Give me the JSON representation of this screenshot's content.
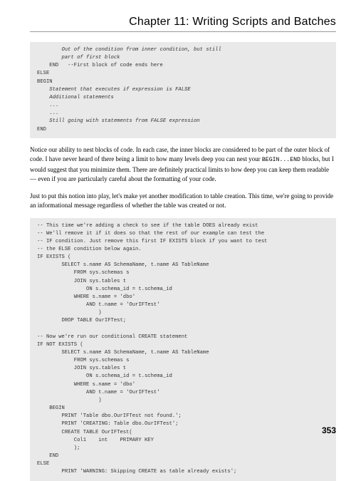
{
  "chapter_title": "Chapter 11: Writing Scripts and Batches",
  "code1": {
    "l1": "        Out of the condition from inner condition, but still",
    "l2": "        part of first block",
    "l3": "    END   --First block of code ends here",
    "l4": "ELSE",
    "l5": "BEGIN",
    "l6": "    Statement that executes if expression is FALSE",
    "l7": "    Additional statements",
    "l8": "    ...",
    "l9": "    ...",
    "l10": "    Still going with statements from FALSE expression",
    "l11": "END"
  },
  "para1_a": "Notice our ability to nest blocks of code. In each case, the inner blocks are considered to be part of the outer block of code. I have never heard of there being a limit to how many levels deep you can nest your ",
  "para1_mono": "BEGIN...END",
  "para1_b": " blocks, but I would suggest that you minimize them. There are definitely practical limits to how deep you can keep them readable — even if you are particularly careful about the formatting of your code.",
  "para2": "Just to put this notion into play, let's make yet another modification to table creation. This time, we're going to provide an informational message regardless of whether the table was created or not.",
  "code2": {
    "l1": "-- This time we're adding a check to see if the table DOES already exist",
    "l2": "-- We'll remove it if it does so that the rest of our example can test the",
    "l3": "-- IF condition. Just remove this first IF EXISTS block if you want to test",
    "l4": "-- the ELSE condition below again.",
    "l5": "IF EXISTS (",
    "l6": "        SELECT s.name AS SchemaName, t.name AS TableName",
    "l7": "            FROM sys.schemas s",
    "l8": "            JOIN sys.tables t",
    "l9": "                ON s.schema_id = t.schema_id",
    "l10": "            WHERE s.name = 'dbo'",
    "l11": "                AND t.name = 'OurIFTest'",
    "l12": "                    )",
    "l13": "        DROP TABLE OurIFTest;",
    "l14": "",
    "l15": "-- Now we're run our conditional CREATE statement",
    "l16": "IF NOT EXISTS (",
    "l17": "        SELECT s.name AS SchemaName, t.name AS TableName",
    "l18": "            FROM sys.schemas s",
    "l19": "            JOIN sys.tables t",
    "l20": "                ON s.schema_id = t.schema_id",
    "l21": "            WHERE s.name = 'dbo'",
    "l22": "                AND t.name = 'OurIFTest'",
    "l23": "                    )",
    "l24": "    BEGIN",
    "l25": "        PRINT 'Table dbo.OurIFTest not found.';",
    "l26": "        PRINT 'CREATING: Table dbo.OurIFTest';",
    "l27": "        CREATE TABLE OurIFTest(",
    "l28": "            Col1    int    PRIMARY KEY",
    "l29": "            );",
    "l30": "    END",
    "l31": "ELSE",
    "l32": "        PRINT 'WARNING: Skipping CREATE as table already exists';"
  },
  "page_number": "353"
}
